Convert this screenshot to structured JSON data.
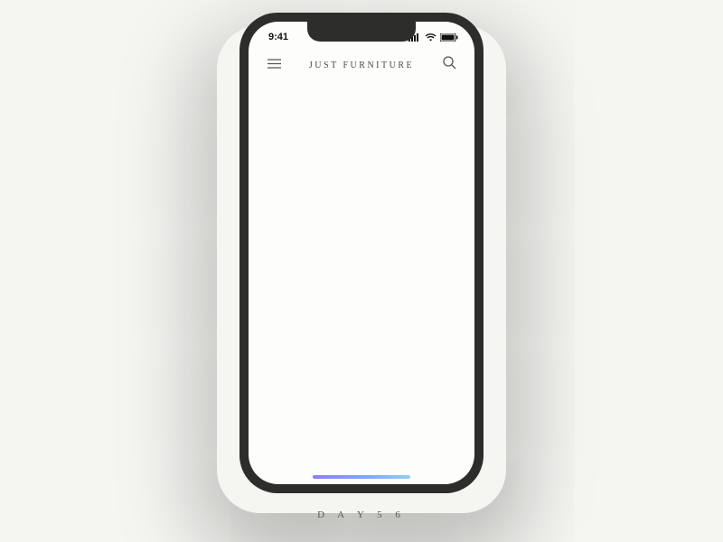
{
  "status_bar": {
    "time": "9:41"
  },
  "header": {
    "title": "JUST FURNITURE"
  },
  "caption": "D A Y  5 6",
  "icons": {
    "menu": "menu-icon",
    "search": "search-icon",
    "signal": "signal-icon",
    "wifi": "wifi-icon",
    "battery": "battery-icon"
  },
  "colors": {
    "phone_frame": "#2d2d2b",
    "screen_bg": "#fdfdfc",
    "page_bg": "#f5f5f2",
    "indicator_start": "#8e7ef2",
    "indicator_end": "#8fd0f2"
  }
}
